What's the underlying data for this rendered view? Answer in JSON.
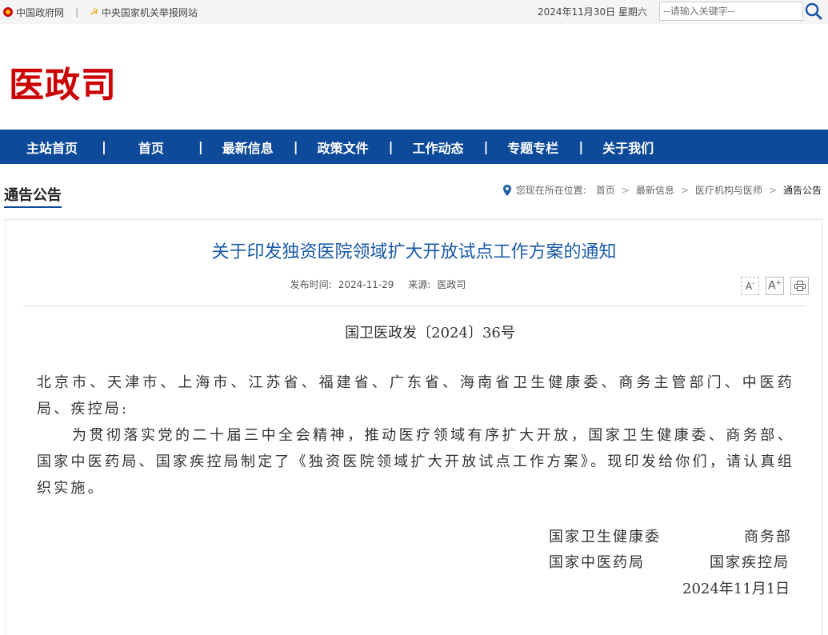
{
  "topbar": {
    "link_gov": "中国政府网",
    "separator": "|",
    "link_report": "中央国家机关举报网站",
    "date": "2024年11月30日 星期六",
    "search_placeholder": "--请输入关键字--"
  },
  "logo": "医政司",
  "nav": [
    {
      "label": "主站首页"
    },
    {
      "label": "首页"
    },
    {
      "label": "最新信息"
    },
    {
      "label": "政策文件"
    },
    {
      "label": "工作动态"
    },
    {
      "label": "专题专栏"
    },
    {
      "label": "关于我们"
    }
  ],
  "nav_sep": "|",
  "section": {
    "title": "通告公告",
    "breadcrumb_prefix": "您现在所在位置:",
    "crumbs": [
      "首页",
      "最新信息",
      "医疗机构与医师",
      "通告公告"
    ],
    "arrow": ">"
  },
  "article": {
    "title": "关于印发独资医院领域扩大开放试点工作方案的通知",
    "publish_label": "发布时间:",
    "publish_date": "2024-11-29",
    "source_label": "来源:",
    "source": "医政司",
    "font_small": "A",
    "font_large": "A",
    "doc_number": "国卫医政发〔2024〕36号",
    "recipients": "北京市、天津市、上海市、江苏省、福建省、广东省、海南省卫生健康委、商务主管部门、中医药局、疾控局:",
    "body": "为贯彻落实党的二十届三中全会精神，推动医疗领域有序扩大开放，国家卫生健康委、商务部、国家中医药局、国家疾控局制定了《独资医院领域扩大开放试点工作方案》。现印发给你们，请认真组织实施。",
    "signers": [
      "国家卫生健康委",
      "商务部",
      "国家中医药局",
      "国家疾控局"
    ],
    "sign_date": "2024年11月1日"
  },
  "colors": {
    "nav_bg": "#0d4a9a",
    "logo": "#cc0000",
    "title": "#1a5aa8"
  }
}
